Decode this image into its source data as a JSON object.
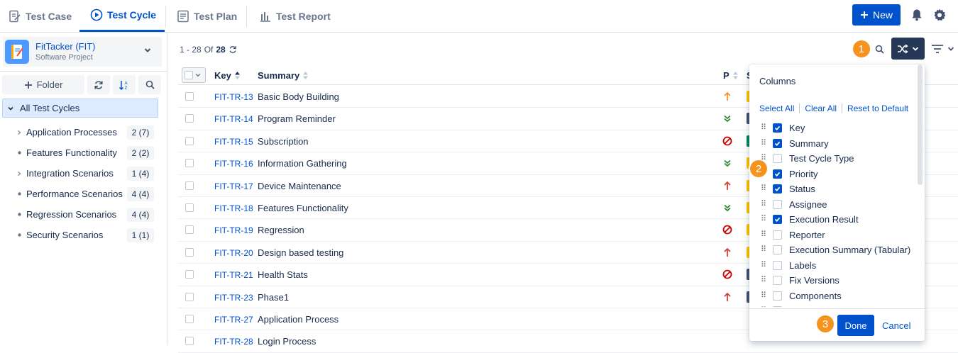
{
  "tabs": [
    {
      "label": "Test Case",
      "icon": "test-case-icon"
    },
    {
      "label": "Test Cycle",
      "icon": "test-cycle-icon"
    },
    {
      "label": "Test Plan",
      "icon": "test-plan-icon"
    },
    {
      "label": "Test Report",
      "icon": "test-report-icon"
    }
  ],
  "header": {
    "new_label": "New"
  },
  "project": {
    "name": "FitTacker (FIT)",
    "type": "Software Project"
  },
  "sidebar": {
    "folder_label": "Folder",
    "all_label": "All Test Cycles",
    "items": [
      {
        "label": "Application Processes",
        "count": "2 (7)",
        "expandable": true
      },
      {
        "label": "Features Functionality",
        "count": "2 (2)",
        "expandable": false
      },
      {
        "label": "Integration Scenarios",
        "count": "1 (4)",
        "expandable": true
      },
      {
        "label": "Performance Scenarios",
        "count": "4 (4)",
        "expandable": false
      },
      {
        "label": "Regression Scenarios",
        "count": "4 (4)",
        "expandable": false
      },
      {
        "label": "Security Scenarios",
        "count": "1 (1)",
        "expandable": false
      }
    ]
  },
  "pager": {
    "range": "1 - 28",
    "of": "Of",
    "total": "28"
  },
  "table": {
    "col_key": "Key",
    "col_summary": "Summary",
    "col_priority": "P",
    "col_status": "S",
    "rows": [
      {
        "key": "FIT-TR-13",
        "summary": "Basic Body Building",
        "priority": "medium",
        "status_color": "#ffc400"
      },
      {
        "key": "FIT-TR-14",
        "summary": "Program Reminder",
        "priority": "lowest",
        "status_color": "#42526e"
      },
      {
        "key": "FIT-TR-15",
        "summary": "Subscription",
        "priority": "blocker",
        "status_color": "#00875a"
      },
      {
        "key": "FIT-TR-16",
        "summary": "Information Gathering",
        "priority": "lowest",
        "status_color": "#ffc400"
      },
      {
        "key": "FIT-TR-17",
        "summary": "Device Maintenance",
        "priority": "high",
        "status_color": "#ffc400"
      },
      {
        "key": "FIT-TR-18",
        "summary": "Features Functionality",
        "priority": "lowest",
        "status_color": "#ffc400"
      },
      {
        "key": "FIT-TR-19",
        "summary": "Regression",
        "priority": "blocker",
        "status_color": "#ffc400"
      },
      {
        "key": "FIT-TR-20",
        "summary": "Design based testing",
        "priority": "high",
        "status_color": "#ffc400"
      },
      {
        "key": "FIT-TR-21",
        "summary": "Health Stats",
        "priority": "blocker",
        "status_color": "#42526e"
      },
      {
        "key": "FIT-TR-23",
        "summary": "Phase1",
        "priority": "high",
        "status_color": "#42526e"
      },
      {
        "key": "FIT-TR-27",
        "summary": "Application Process",
        "priority": "",
        "status_color": ""
      },
      {
        "key": "FIT-TR-28",
        "summary": "Login Process",
        "priority": "",
        "status_color": ""
      }
    ]
  },
  "columns_panel": {
    "title": "Columns",
    "select_all": "Select All",
    "clear_all": "Clear All",
    "reset": "Reset to Default",
    "items": [
      {
        "label": "Key",
        "checked": true
      },
      {
        "label": "Summary",
        "checked": true
      },
      {
        "label": "Test Cycle Type",
        "checked": false
      },
      {
        "label": "Priority",
        "checked": true
      },
      {
        "label": "Status",
        "checked": true
      },
      {
        "label": "Assignee",
        "checked": false
      },
      {
        "label": "Execution Result",
        "checked": true
      },
      {
        "label": "Reporter",
        "checked": false
      },
      {
        "label": "Execution Summary (Tabular)",
        "checked": false
      },
      {
        "label": "Labels",
        "checked": false
      },
      {
        "label": "Fix Versions",
        "checked": false
      },
      {
        "label": "Components",
        "checked": false
      },
      {
        "label": "Sprint",
        "checked": false
      }
    ],
    "done_label": "Done",
    "cancel_label": "Cancel"
  },
  "callouts": [
    "1",
    "2",
    "3"
  ],
  "colors": {
    "accent": "#0052cc",
    "callout": "#f6921e",
    "selected_bg": "#deebff"
  }
}
